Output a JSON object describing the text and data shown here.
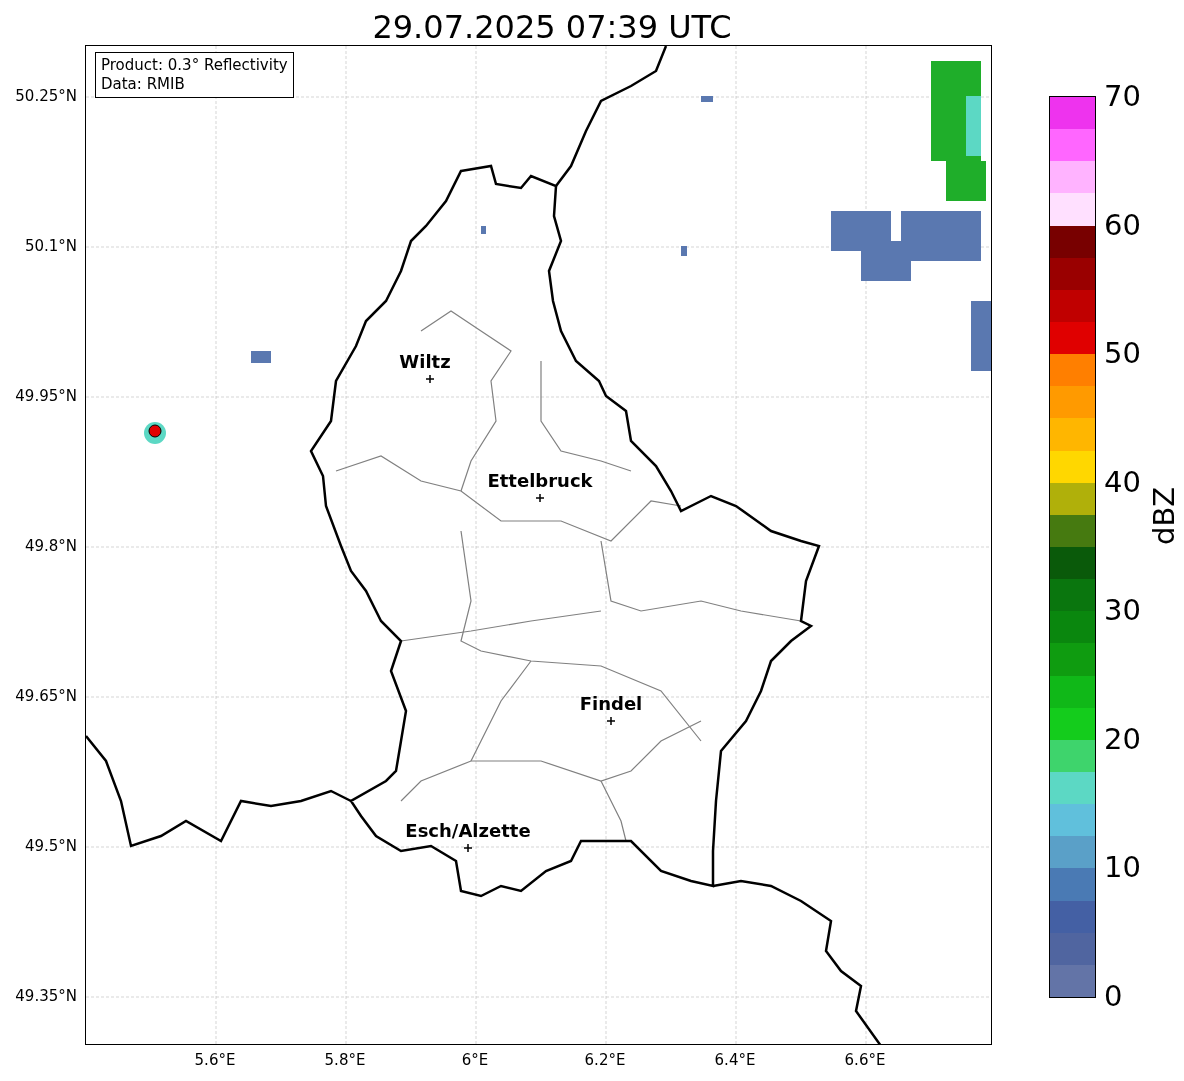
{
  "title": "29.07.2025 07:39 UTC",
  "info_box": {
    "lines": [
      "Product: 0.3° Reflectivity",
      "Data: RMIB"
    ]
  },
  "y_ticks": [
    "50.25°N",
    "50.1°N",
    "49.95°N",
    "49.8°N",
    "49.65°N",
    "49.5°N",
    "49.35°N"
  ],
  "x_ticks": [
    "5.6°E",
    "5.8°E",
    "6°E",
    "6.2°E",
    "6.4°E",
    "6.6°E"
  ],
  "cities": [
    {
      "name": "Wiltz"
    },
    {
      "name": "Ettelbruck"
    },
    {
      "name": "Findel"
    },
    {
      "name": "Esch/Alzette"
    }
  ],
  "colorbar": {
    "label": "dBZ",
    "ticks": [
      "70",
      "60",
      "50",
      "40",
      "30",
      "20",
      "10",
      "0"
    ],
    "segments": [
      {
        "color": "#ee33ee"
      },
      {
        "color": "#ff66ff"
      },
      {
        "color": "#ffb3ff"
      },
      {
        "color": "#ffe0ff"
      },
      {
        "color": "#780000"
      },
      {
        "color": "#9a0000"
      },
      {
        "color": "#c00000"
      },
      {
        "color": "#e00000"
      },
      {
        "color": "#ff7f00"
      },
      {
        "color": "#ff9a00"
      },
      {
        "color": "#ffb600"
      },
      {
        "color": "#ffd700"
      },
      {
        "color": "#b0b00a"
      },
      {
        "color": "#467a10"
      },
      {
        "color": "#0a5a0a"
      },
      {
        "color": "#0a760e"
      },
      {
        "color": "#0a870e"
      },
      {
        "color": "#0f9c10"
      },
      {
        "color": "#10b818"
      },
      {
        "color": "#14cc1c"
      },
      {
        "color": "#3ed46c"
      },
      {
        "color": "#5cd8c4"
      },
      {
        "color": "#60c0dc"
      },
      {
        "color": "#5aa0c8"
      },
      {
        "color": "#4a7ab4"
      },
      {
        "color": "#4460a4"
      },
      {
        "color": "#5065a0"
      },
      {
        "color": "#6374a7"
      }
    ]
  }
}
